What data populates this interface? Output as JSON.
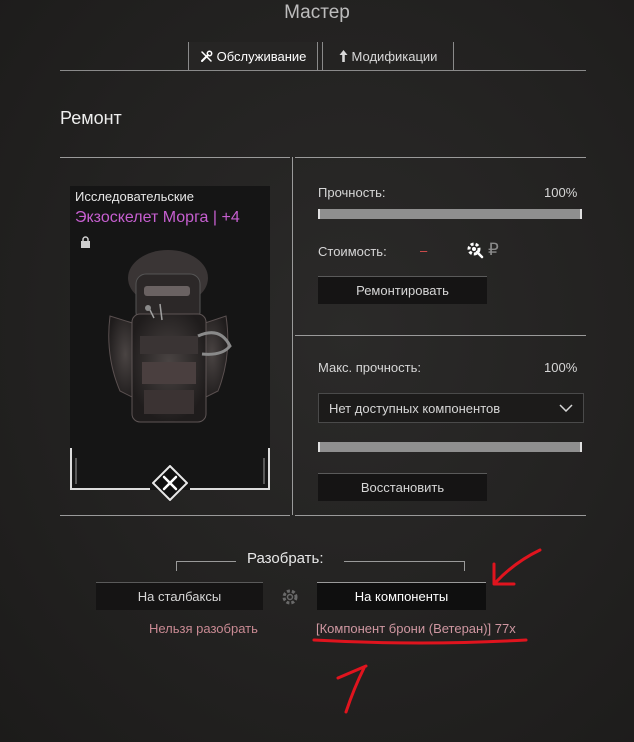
{
  "window": {
    "title": "Мастер"
  },
  "tabs": [
    {
      "label": "Обслуживание",
      "icon": "wrench-icon",
      "active": true
    },
    {
      "label": "Модификации",
      "icon": "upgrade-arrow-icon",
      "active": false
    }
  ],
  "repair": {
    "section_title": "Ремонт",
    "item": {
      "rarity": "Исследовательские",
      "name": "Экзоскелет Морга",
      "upgrade": "| +4",
      "name_color": "#c65fd0",
      "locked": true
    },
    "durability": {
      "label": "Прочность:",
      "value": "100%",
      "fraction": 1.0
    },
    "cost": {
      "label": "Стоимость:",
      "value": "–",
      "currency": "₽"
    },
    "repair_button": "Ремонтировать",
    "max_durability": {
      "label": "Макс. прочность:",
      "value": "100%",
      "fraction": 1.0
    },
    "components_dropdown": {
      "selected": "Нет доступных компонентов"
    },
    "restore_button": "Восстановить"
  },
  "disassemble": {
    "label": "Разобрать:",
    "stalbucks_button": "На сталбаксы",
    "components_button": "На компоненты",
    "stalbucks_note": "Нельзя разобрать",
    "components_note": "[Компонент брони (Ветеран)] 77x"
  },
  "colors": {
    "accent_purple": "#c65fd0",
    "annotation_red": "#e0141e",
    "warning_pink": "#c98a93"
  }
}
